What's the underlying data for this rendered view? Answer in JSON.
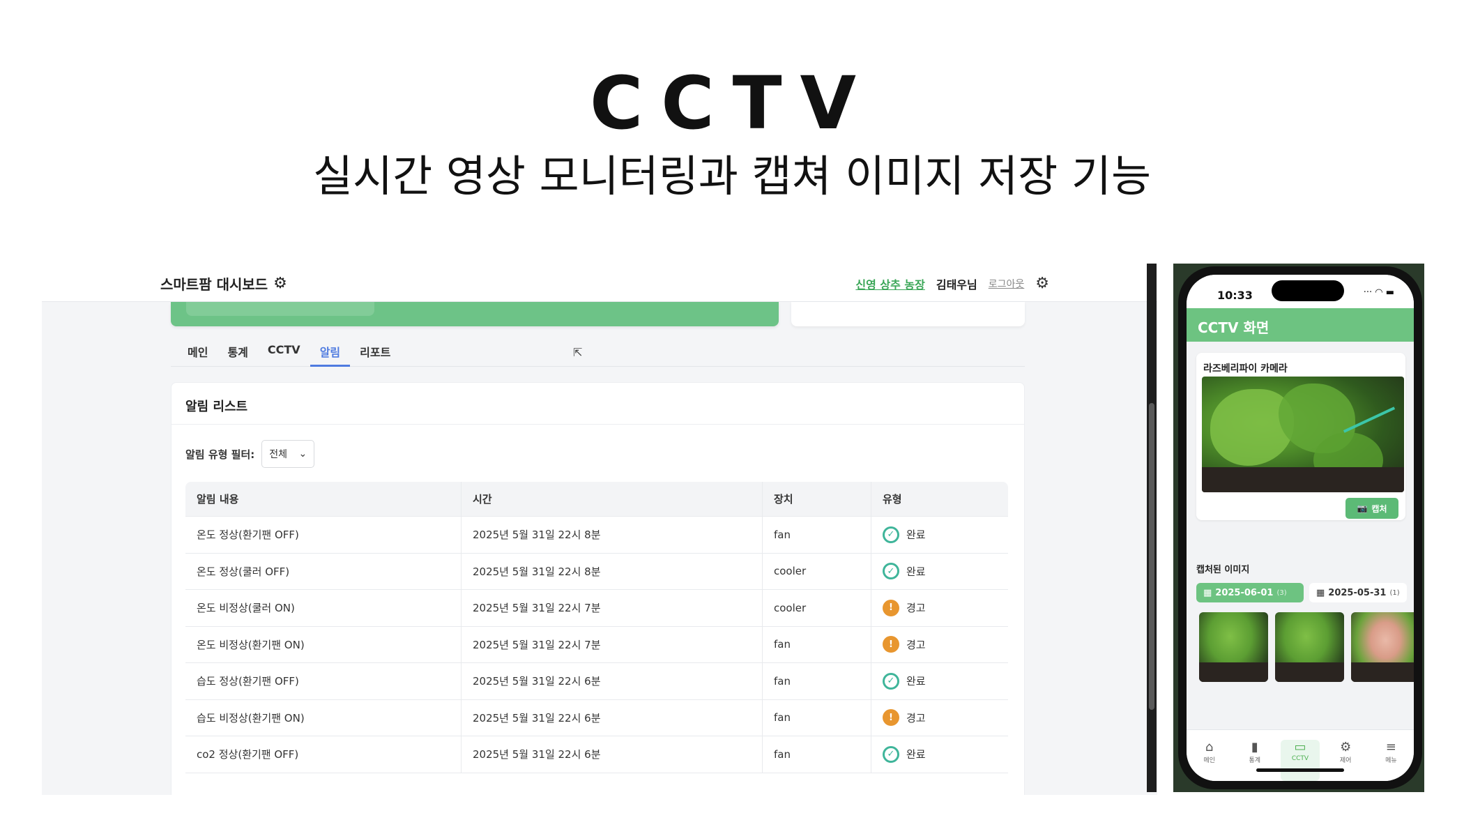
{
  "slide": {
    "title": "CCTV",
    "subtitle": "실시간 영상 모니터링과 캡쳐 이미지 저장 기능"
  },
  "desktop": {
    "brand": "스마트팜 대시보드",
    "farm_link": "신영 상추 농장",
    "user": "김태우님",
    "logout": "로그아웃",
    "tabs": [
      "메인",
      "통계",
      "CCTV",
      "알림",
      "리포트"
    ],
    "active_tab": "알림",
    "panel_title": "알림 리스트",
    "filter_label": "알림 유형 필터:",
    "filter_value": "전체",
    "table": {
      "headers": [
        "알림 내용",
        "시간",
        "장치",
        "유형"
      ],
      "rows": [
        {
          "content": "온도 정상(환기팬 OFF)",
          "time": "2025년 5월 31일 22시 8분",
          "device": "fan",
          "type": "완료",
          "status": "ok"
        },
        {
          "content": "온도 정상(쿨러 OFF)",
          "time": "2025년 5월 31일 22시 8분",
          "device": "cooler",
          "type": "완료",
          "status": "ok"
        },
        {
          "content": "온도 비정상(쿨러 ON)",
          "time": "2025년 5월 31일 22시 7분",
          "device": "cooler",
          "type": "경고",
          "status": "warn"
        },
        {
          "content": "온도 비정상(환기팬 ON)",
          "time": "2025년 5월 31일 22시 7분",
          "device": "fan",
          "type": "경고",
          "status": "warn"
        },
        {
          "content": "습도 정상(환기팬 OFF)",
          "time": "2025년 5월 31일 22시 6분",
          "device": "fan",
          "type": "완료",
          "status": "ok"
        },
        {
          "content": "습도 비정상(환기팬 ON)",
          "time": "2025년 5월 31일 22시 6분",
          "device": "fan",
          "type": "경고",
          "status": "warn"
        },
        {
          "content": "co2 정상(환기팬 OFF)",
          "time": "2025년 5월 31일 22시 6분",
          "device": "fan",
          "type": "완료",
          "status": "ok"
        }
      ]
    },
    "colors": {
      "accent": "#4f7be0",
      "brand_green": "#6dc387",
      "ok": "#3fb59a",
      "warn": "#e8962f"
    }
  },
  "phone": {
    "clock": "10:33",
    "app_title": "CCTV 화면",
    "camera_title": "라즈베리파이 카메라",
    "capture_label": "캡처",
    "captured_title": "캡처된 이미지",
    "dates": [
      {
        "date": "2025-06-01",
        "count": "(3)"
      },
      {
        "date": "2025-05-31",
        "count": "(1)"
      }
    ],
    "nav": [
      {
        "label": "메인",
        "icon": "home-icon"
      },
      {
        "label": "통계",
        "icon": "chart-icon"
      },
      {
        "label": "CCTV",
        "icon": "video-icon"
      },
      {
        "label": "제어",
        "icon": "gear-icon"
      },
      {
        "label": "메뉴",
        "icon": "menu-icon"
      }
    ]
  }
}
